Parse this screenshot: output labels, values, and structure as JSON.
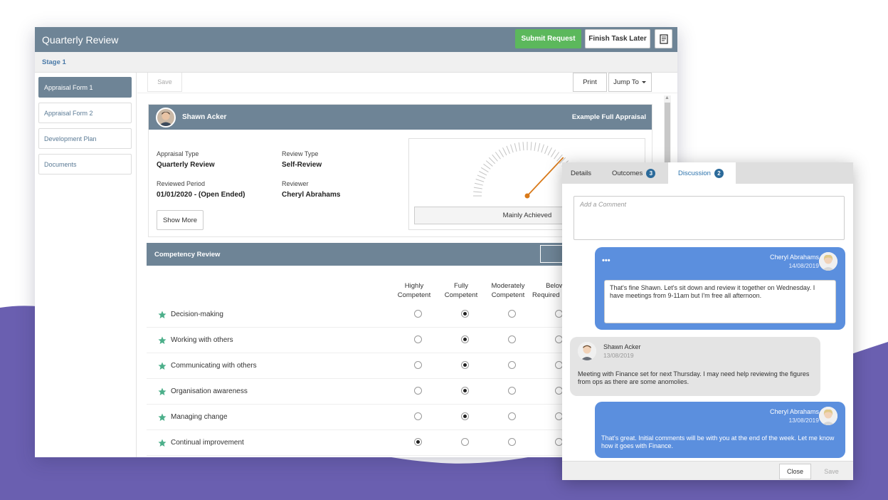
{
  "window": {
    "title": "Quarterly Review",
    "submit_label": "Submit Request",
    "finish_label": "Finish Task Later",
    "notes_icon": "notes-icon"
  },
  "stage": {
    "label": "Stage 1"
  },
  "sidebar": {
    "items": [
      {
        "label": "Appraisal Form 1",
        "active": true
      },
      {
        "label": "Appraisal Form 2",
        "active": false
      },
      {
        "label": "Development Plan",
        "active": false
      },
      {
        "label": "Documents",
        "active": false
      }
    ]
  },
  "toolbar": {
    "save_label": "Save",
    "print_label": "Print",
    "jump_label": "Jump To"
  },
  "employee": {
    "name": "Shawn Acker",
    "appraisal_name": "Example Full Appraisal",
    "appraisal_type_label": "Appraisal Type",
    "appraisal_type": "Quarterly Review",
    "review_type_label": "Review Type",
    "review_type": "Self-Review",
    "reviewed_period_label": "Reviewed Period",
    "reviewed_period": "01/01/2020 - (Open Ended)",
    "reviewer_label": "Reviewer",
    "reviewer": "Cheryl Abrahams",
    "show_more_label": "Show More",
    "gauge_result": "Mainly Achieved"
  },
  "competency": {
    "title": "Competency Review",
    "columns": [
      "Highly Competent",
      "Fully Competent",
      "Moderately Competent",
      "Below Required Level"
    ],
    "rows": [
      {
        "name": "Decision-making",
        "selected": 1
      },
      {
        "name": "Working with others",
        "selected": 1
      },
      {
        "name": "Communicating with others",
        "selected": 1
      },
      {
        "name": "Organisation awareness",
        "selected": 1
      },
      {
        "name": "Managing change",
        "selected": 1
      },
      {
        "name": "Continual improvement",
        "selected": 0
      }
    ]
  },
  "popup": {
    "tabs": {
      "details": "Details",
      "outcomes": "Outcomes",
      "outcomes_count": "3",
      "discussion": "Discussion",
      "discussion_count": "2"
    },
    "comment_placeholder": "Add a Comment",
    "messages": [
      {
        "author": "Cheryl Abrahams",
        "date": "14/08/2019",
        "menu": "•••",
        "text": "That's fine Shawn. Let's sit down and review it together on Wednesday. I have meetings from 9-11am but I'm free all afternoon."
      },
      {
        "author": "Shawn Acker",
        "date": "13/08/2019",
        "text": "Meeting with Finance set for next Thursday. I may need help reviewing the figures from ops as there are some anomolies."
      },
      {
        "author": "Cheryl Abrahams",
        "date": "13/08/2019",
        "text": "That's great. Initial comments will be with you at the end of the week. Let me know how it goes with Finance."
      }
    ],
    "close_label": "Close",
    "save_label": "Save"
  },
  "colors": {
    "header": "#6e8496",
    "submit": "#5cb85c",
    "message_blue": "#5b8fde",
    "accent_orange": "#d97a1a",
    "star_green": "#4caf8a",
    "background_purple": "#6a5fb0"
  }
}
